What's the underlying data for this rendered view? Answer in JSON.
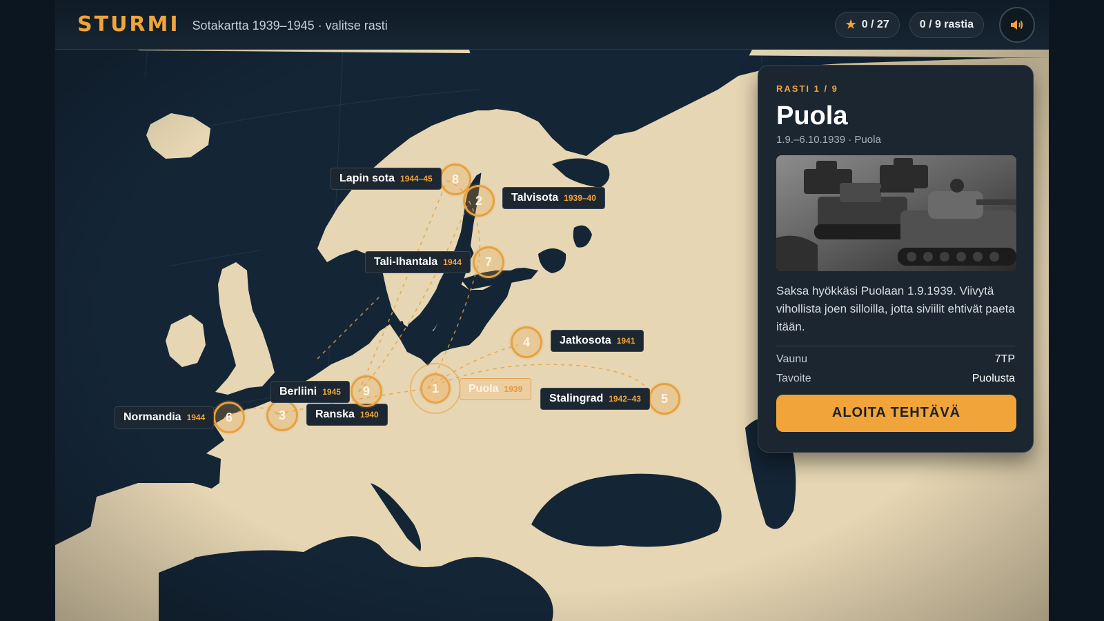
{
  "header": {
    "brand": "STURMI",
    "subtitle": "Sotakartta 1939–1945 · valitse rasti",
    "stars": "0 / 27",
    "checkpoints": "0 / 9 rastia",
    "icons": {
      "stars": "star-icon",
      "sound": "speaker-icon"
    }
  },
  "markers": [
    {
      "num": "1",
      "label": "Puola",
      "year": "1939",
      "active": true
    },
    {
      "num": "2",
      "label": "Talvisota",
      "year": "1939–40"
    },
    {
      "num": "3",
      "label": "Ranska",
      "year": "1940"
    },
    {
      "num": "4",
      "label": "Jatkosota",
      "year": "1941"
    },
    {
      "num": "5",
      "label": "Stalingrad",
      "year": "1942–43"
    },
    {
      "num": "6",
      "label": "Normandia",
      "year": "1944"
    },
    {
      "num": "7",
      "label": "Tali-Ihantala",
      "year": "1944"
    },
    {
      "num": "8",
      "label": "Lapin sota",
      "year": "1944–45"
    },
    {
      "num": "9",
      "label": "Berliini",
      "year": "1945"
    }
  ],
  "panel": {
    "step": "RASTI 1 / 9",
    "title": "Puola",
    "date": "1.9.–6.10.1939 · Puola",
    "photo": "tank-photo",
    "description": "Saksa hyökkäsi Puolaan 1.9.1939. Viivytä vihollista joen silloilla, jotta siviilit ehtivät paeta itään.",
    "rows": [
      {
        "key": "Vaunu",
        "value": "7TP"
      },
      {
        "key": "Tavoite",
        "value": "Puolusta"
      }
    ],
    "cta": "ALOITA TEHTÄVÄ"
  },
  "colors": {
    "accent": "#f0a43a",
    "land": "#e6d6b3",
    "sea": "#142536",
    "panel": "#1b2630"
  }
}
